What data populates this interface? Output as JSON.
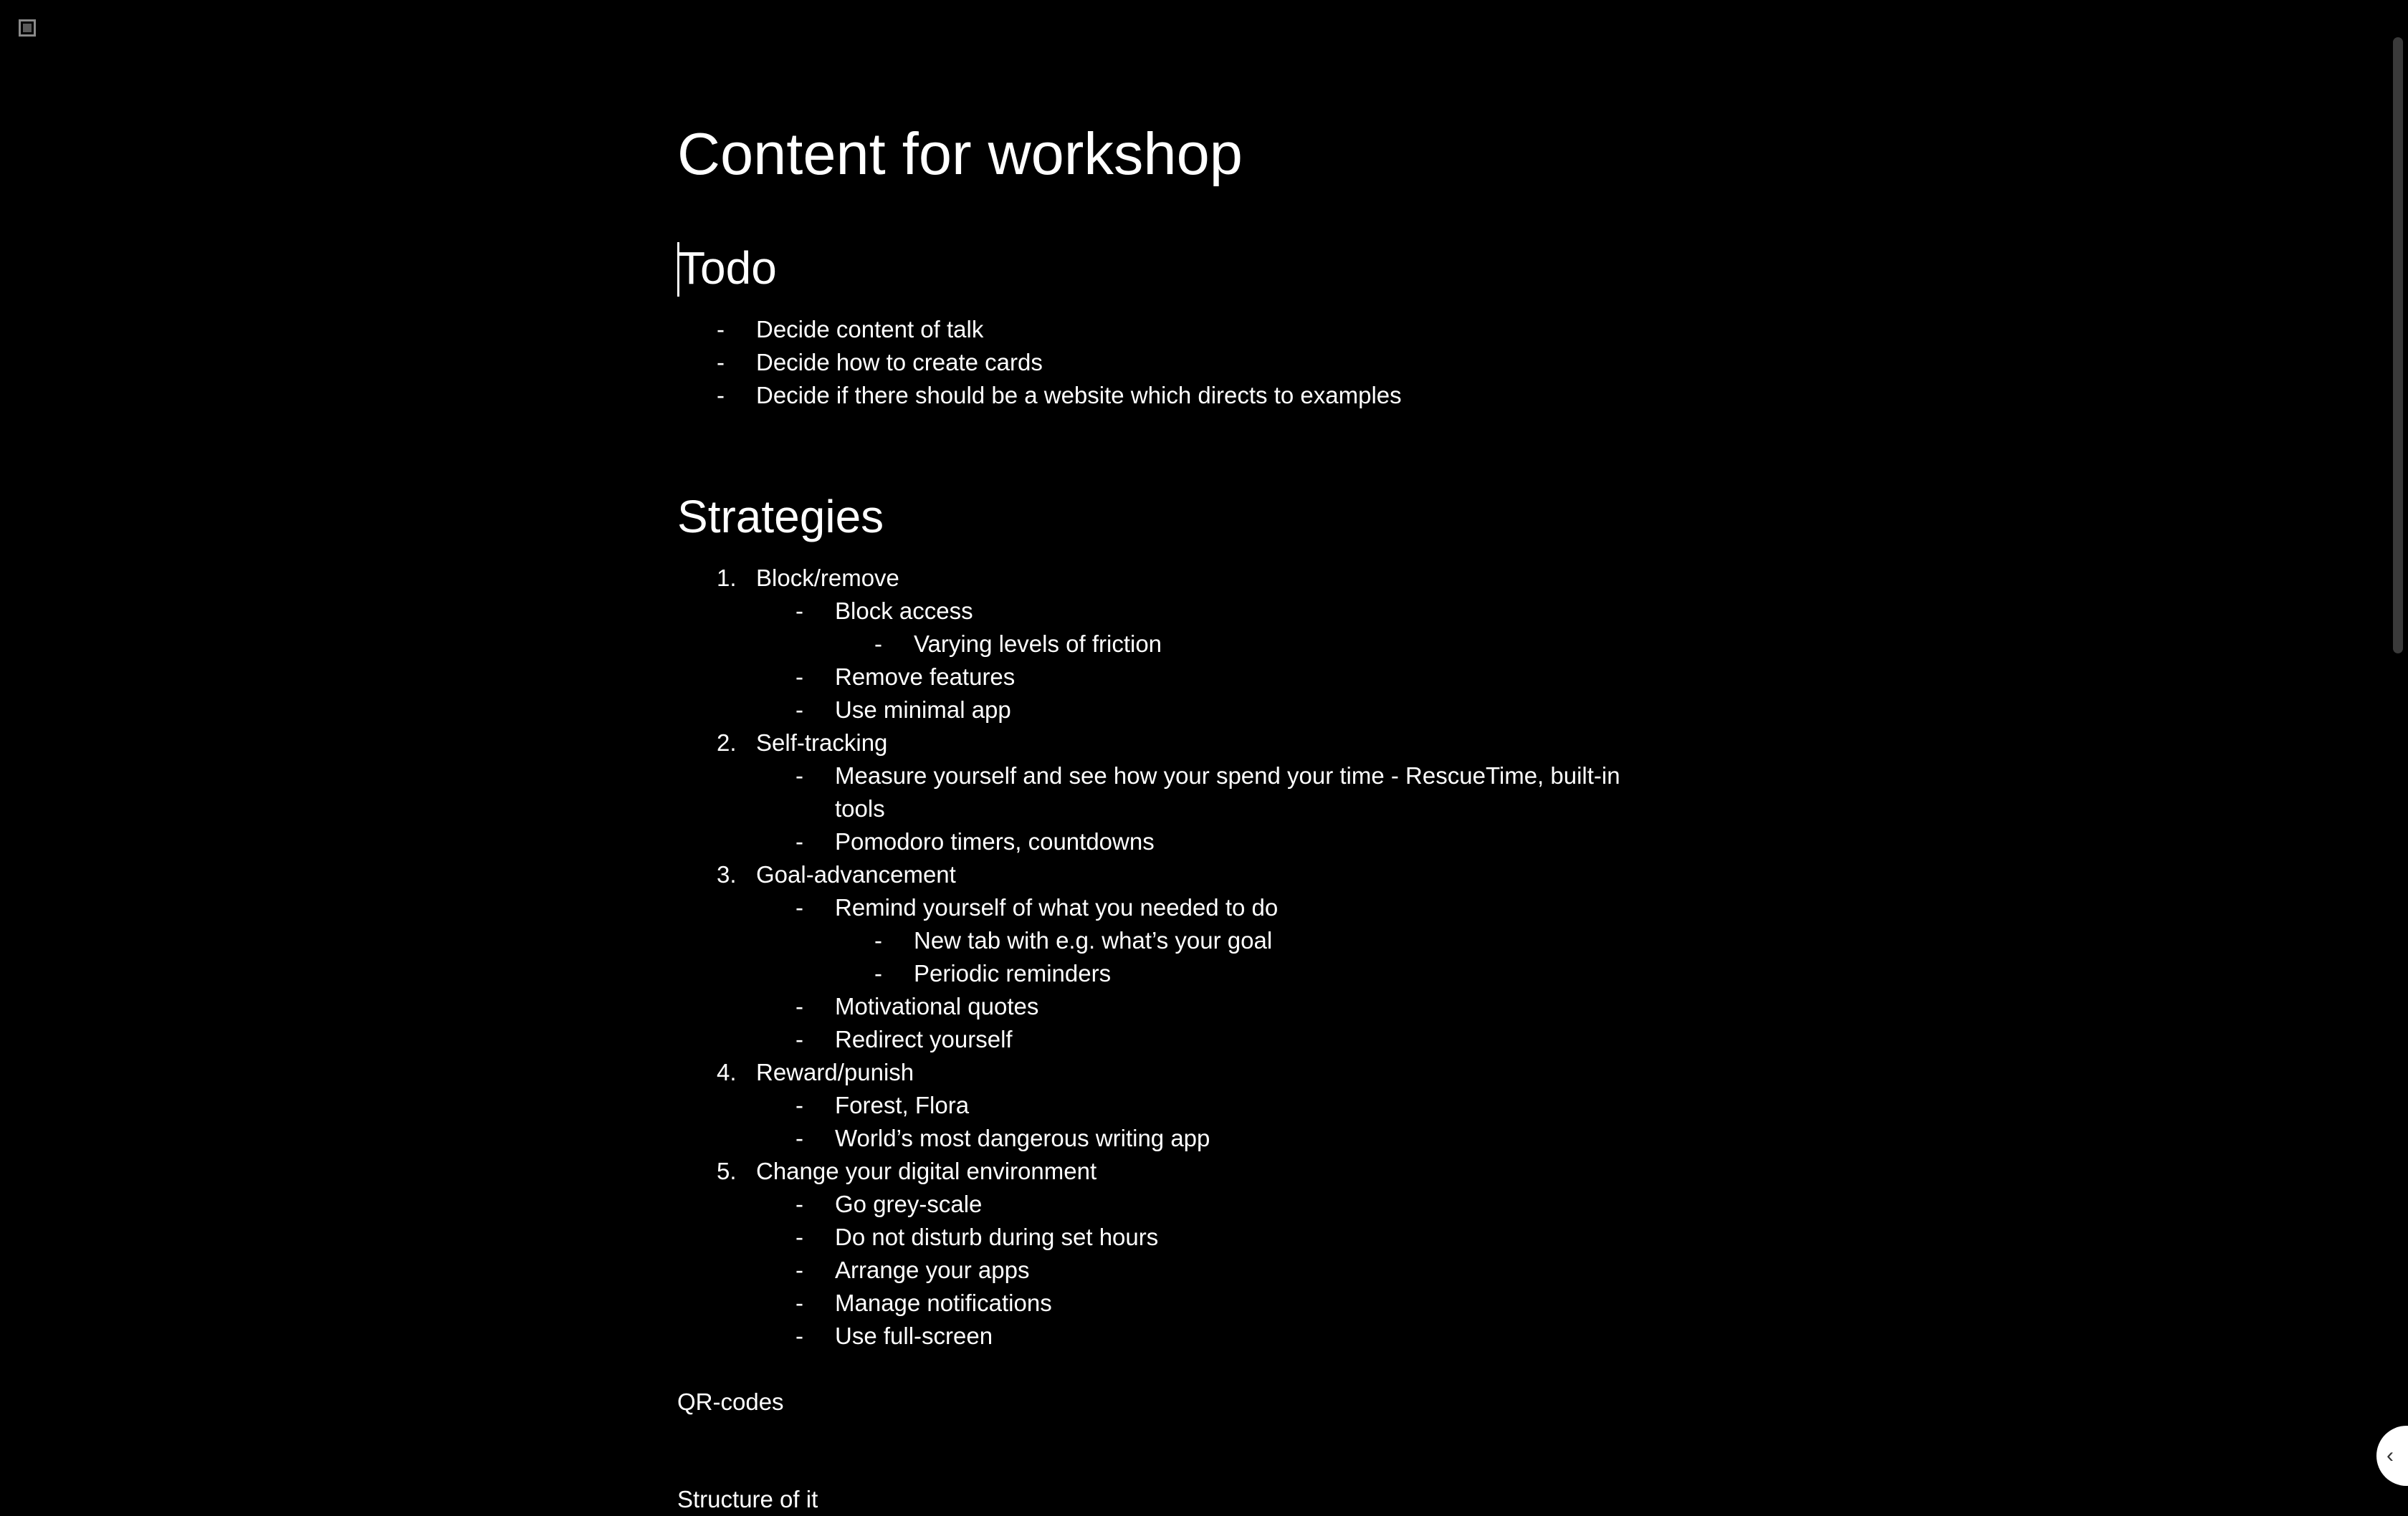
{
  "title": "Content for workshop",
  "todo": {
    "heading": "Todo",
    "items": [
      "Decide content of talk",
      "Decide how to create cards",
      "Decide if there should be a website which directs to examples"
    ]
  },
  "strategies": {
    "heading": "Strategies",
    "rows": [
      {
        "marker": "1.",
        "text": "Block/remove"
      },
      {
        "marker": "-",
        "text": "Block access"
      },
      {
        "marker": "-",
        "text": "Varying levels of friction"
      },
      {
        "marker": "-",
        "text": "Remove features"
      },
      {
        "marker": "-",
        "text": "Use minimal app"
      },
      {
        "marker": "2.",
        "text": "Self-tracking"
      },
      {
        "marker": "-",
        "text": "Measure yourself and see how your spend your time - RescueTime, built-in"
      },
      {
        "marker": "",
        "text": "tools"
      },
      {
        "marker": "-",
        "text": "Pomodoro timers, countdowns"
      },
      {
        "marker": "3.",
        "text": "Goal-advancement"
      },
      {
        "marker": "-",
        "text": "Remind yourself of what you needed to do"
      },
      {
        "marker": "-",
        "text": "New tab with e.g. what’s your goal"
      },
      {
        "marker": "-",
        "text": "Periodic reminders"
      },
      {
        "marker": "-",
        "text": "Motivational quotes"
      },
      {
        "marker": "-",
        "text": "Redirect yourself"
      },
      {
        "marker": "4.",
        "text": "Reward/punish"
      },
      {
        "marker": "-",
        "text": "Forest, Flora"
      },
      {
        "marker": "-",
        "text": "World’s most dangerous writing app"
      },
      {
        "marker": "5.",
        "text": "Change your digital environment"
      },
      {
        "marker": "-",
        "text": "Go grey-scale"
      },
      {
        "marker": "-",
        "text": "Do not disturb during set hours"
      },
      {
        "marker": "-",
        "text": "Arrange your apps"
      },
      {
        "marker": "-",
        "text": "Manage notifications"
      },
      {
        "marker": "-",
        "text": "Use full-screen"
      }
    ]
  },
  "qr_codes": "QR-codes",
  "structure": "Structure of it",
  "icons": {
    "app": "app-window-icon",
    "collapse": "chevron-left-icon"
  },
  "colors": {
    "background": "#000000",
    "text": "#ffffff"
  }
}
